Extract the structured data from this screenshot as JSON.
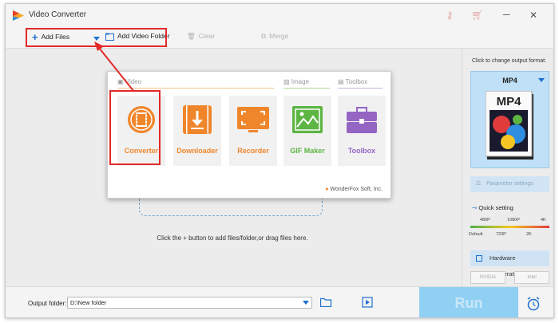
{
  "window": {
    "title": "Video Converter",
    "accent_color": "#1d6fd0",
    "highlight_color": "#e32a2a"
  },
  "toolbar": {
    "add_files": "Add Files",
    "add_video_folder": "Add Video Folder",
    "clear": "Clear",
    "merge": "Merge"
  },
  "popup": {
    "sections": {
      "video": "Video",
      "image": "Image",
      "toolbox": "Toolbox"
    },
    "tiles": [
      {
        "label": "Converter",
        "color": "#f0862b",
        "icon": "film-reel-icon"
      },
      {
        "label": "Downloader",
        "color": "#f0862b",
        "icon": "download-icon"
      },
      {
        "label": "Recorder",
        "color": "#f0862b",
        "icon": "screen-record-icon"
      },
      {
        "label": "GIF Maker",
        "color": "#5db544",
        "icon": "picture-icon"
      },
      {
        "label": "Toolbox",
        "color": "#9565c4",
        "icon": "toolbox-icon"
      }
    ],
    "brand": "WonderFox Soft, Inc."
  },
  "workspace": {
    "hint": "Click the + button to add files/folder,or drag files here."
  },
  "right_panel": {
    "change_format_hint": "Click to change output format:",
    "format": "MP4",
    "format_badge": "MP4",
    "parameter_settings": "Parameter settings",
    "quick_setting": "Quick setting",
    "quality_top": [
      "480P",
      "1080P",
      "4K"
    ],
    "quality_bottom": [
      "Default",
      "720P",
      "2K"
    ],
    "hardware_acceleration": "Hardware acceleration",
    "nvidia": "NVIDIA",
    "intel": "Intel"
  },
  "bottom": {
    "output_folder_label": "Output folder:",
    "output_folder_value": "D:\\New folder",
    "run": "Run"
  }
}
